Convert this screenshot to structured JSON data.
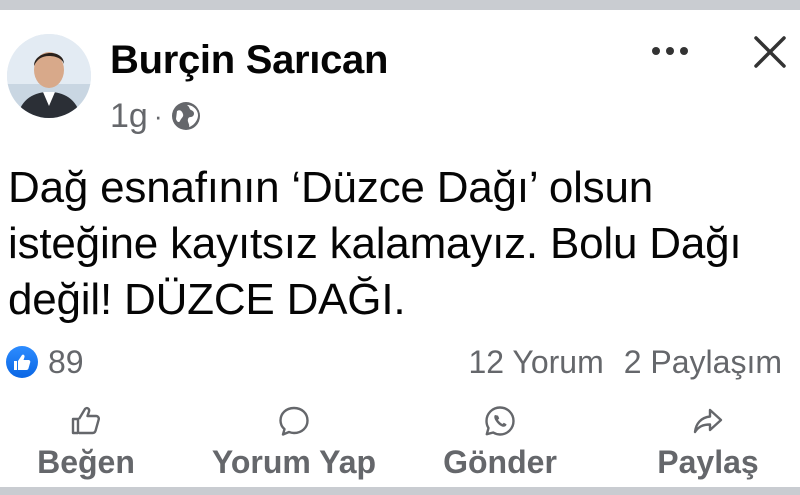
{
  "post": {
    "author": "Burçin Sarıcan",
    "time": "1g",
    "separator": "·",
    "text": "Dağ esnafının ‘Düzce Dağı’ olsun isteğine kayıtsız kalamayız. Bolu Dağı değil! DÜZCE DAĞI."
  },
  "reactions": {
    "count": "89"
  },
  "stats": {
    "comments": "12 Yorum",
    "shares": "2 Paylaşım"
  },
  "actions": {
    "like": "Beğen",
    "comment": "Yorum Yap",
    "send": "Gönder",
    "share": "Paylaş"
  },
  "icons": {
    "avatar": "profile-photo",
    "audience": "globe-icon",
    "more": "more-options-icon",
    "close": "close-icon",
    "like_badge": "thumbs-up-icon",
    "like": "thumbs-up-outline-icon",
    "comment": "speech-bubble-icon",
    "send": "whatsapp-icon",
    "share": "share-arrow-icon"
  },
  "colors": {
    "text": "#050505",
    "muted": "#65676b",
    "like_blue": "#1877f2",
    "divider": "#c9ccd1"
  }
}
